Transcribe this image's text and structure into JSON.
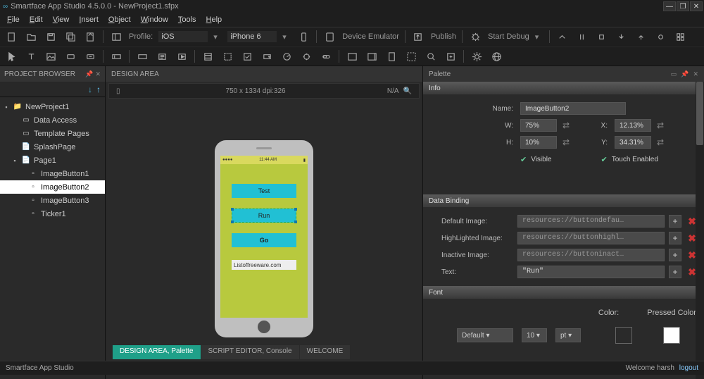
{
  "title": "Smartface App Studio 4.5.0.0 - NewProject1.sfpx",
  "menu": [
    "File",
    "Edit",
    "View",
    "Insert",
    "Object",
    "Window",
    "Tools",
    "Help"
  ],
  "toolbar1": {
    "profile_label": "Profile:",
    "profile_value": "iOS",
    "device_value": "iPhone 6",
    "emulator": "Device Emulator",
    "publish": "Publish",
    "debug": "Start Debug"
  },
  "project_browser": {
    "title": "PROJECT BROWSER",
    "root": "NewProject1",
    "items": [
      {
        "label": "Data Access"
      },
      {
        "label": "Template Pages"
      },
      {
        "label": "SplashPage"
      },
      {
        "label": "Page1"
      }
    ],
    "page1_children": [
      "ImageButton1",
      "ImageButton2",
      "ImageButton3",
      "Ticker1"
    ],
    "selected": "ImageButton2"
  },
  "design": {
    "title": "DESIGN AREA",
    "dims": "750 x 1334 dpi:326",
    "na": "N/A",
    "phone": {
      "time": "11:44 AM",
      "btn1": "Test",
      "btn2": "Run",
      "btn3": "Go",
      "ticker": "Listoffreeware.com"
    }
  },
  "palette": {
    "title": "Palette",
    "sec_info": "Info",
    "name_lbl": "Name:",
    "name_val": "ImageButton2",
    "w_lbl": "W:",
    "w_val": "75%",
    "h_lbl": "H:",
    "h_val": "10%",
    "x_lbl": "X:",
    "x_val": "12.13%",
    "y_lbl": "Y:",
    "y_val": "34.31%",
    "visible": "Visible",
    "touch": "Touch Enabled",
    "sec_db": "Data Binding",
    "default_img_lbl": "Default Image:",
    "default_img_val": "resources://buttondefau…",
    "high_img_lbl": "HighLighted Image:",
    "high_img_val": "resources://buttonhighl…",
    "inact_img_lbl": "Inactive Image:",
    "inact_img_val": "resources://buttoninact…",
    "text_lbl": "Text:",
    "text_val": "\"Run\"",
    "sec_font": "Font",
    "font_family": "Default",
    "font_size": "10",
    "font_unit": "pt",
    "color_lbl": "Color:",
    "pressed_lbl": "Pressed Color:"
  },
  "bottom_tabs": [
    "DESIGN AREA, Palette",
    "SCRIPT EDITOR, Console",
    "WELCOME"
  ],
  "status": {
    "left": "Smartface App Studio",
    "right_a": "Welcome harsh",
    "right_b": "logout"
  }
}
